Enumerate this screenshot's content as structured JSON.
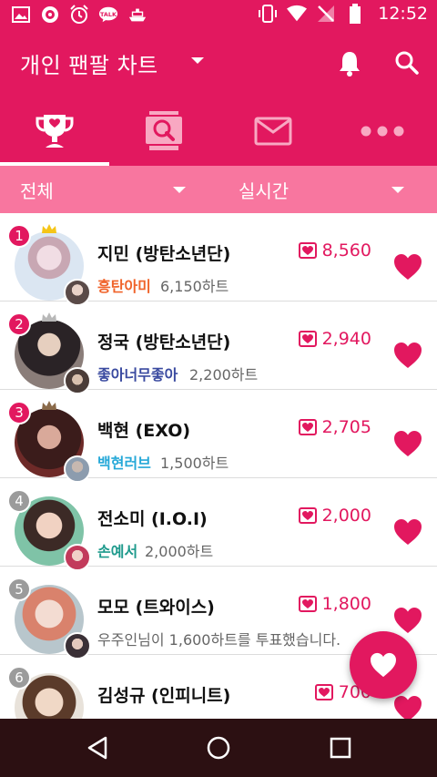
{
  "status": {
    "time": "12:52",
    "left_icons": [
      "gallery-icon",
      "app-icon",
      "alarm-icon",
      "talk-icon",
      "ship-icon"
    ],
    "right_icons": [
      "vibrate-icon",
      "wifi-icon",
      "no-signal-icon",
      "battery-icon"
    ],
    "talk_label": "TALK"
  },
  "app_bar": {
    "title": "개인 팬팔 차트",
    "icons": [
      "dropdown-caret-icon",
      "bell-icon",
      "search-icon"
    ]
  },
  "tabs": [
    {
      "icon": "trophy-icon",
      "active": true
    },
    {
      "icon": "search-card-icon",
      "active": false
    },
    {
      "icon": "mail-icon",
      "active": false
    },
    {
      "icon": "more-icon",
      "active": false
    }
  ],
  "filters": {
    "category": "전체",
    "period": "실시간"
  },
  "colors": {
    "primary": "#e2185f",
    "filter_bg": "#f8769f",
    "nav_bg": "#2c1012"
  },
  "rows": [
    {
      "rank": "1",
      "rank_color": "#e2185f",
      "crown": "gold",
      "name": "지민 (방탄소년단)",
      "score": "8,560",
      "fan_name": "흥탄아미",
      "fan_color": "#f0632a",
      "fan_hearts": "6,150하트",
      "note": ""
    },
    {
      "rank": "2",
      "rank_color": "#e2185f",
      "crown": "silver",
      "name": "정국 (방탄소년단)",
      "score": "2,940",
      "fan_name": "좋아너무좋아",
      "fan_color": "#3a4aa0",
      "fan_hearts": "2,200하트",
      "note": ""
    },
    {
      "rank": "3",
      "rank_color": "#e2185f",
      "crown": "bronze",
      "name": "백현 (EXO)",
      "score": "2,705",
      "fan_name": "백현러브",
      "fan_color": "#25a8d8",
      "fan_hearts": "1,500하트",
      "note": ""
    },
    {
      "rank": "4",
      "rank_color": "#9b9b9b",
      "crown": "",
      "name": "전소미 (I.O.I)",
      "score": "2,000",
      "fan_name": "손예서",
      "fan_color": "#1e9a8c",
      "fan_hearts": "2,000하트",
      "note": ""
    },
    {
      "rank": "5",
      "rank_color": "#9b9b9b",
      "crown": "",
      "name": "모모 (트와이스)",
      "score": "1,800",
      "fan_name": "",
      "fan_color": "",
      "fan_hearts": "",
      "note": "우주인님이 1,600하트를 투표했습니다."
    },
    {
      "rank": "6",
      "rank_color": "#9b9b9b",
      "crown": "",
      "name": "김성규 (인피니트)",
      "score": "700",
      "fan_name": "",
      "fan_color": "",
      "fan_hearts": "",
      "note": ""
    }
  ],
  "fab": {
    "icon": "heart-icon"
  },
  "nav": {
    "icons": [
      "back-icon",
      "home-icon",
      "recents-icon"
    ]
  }
}
